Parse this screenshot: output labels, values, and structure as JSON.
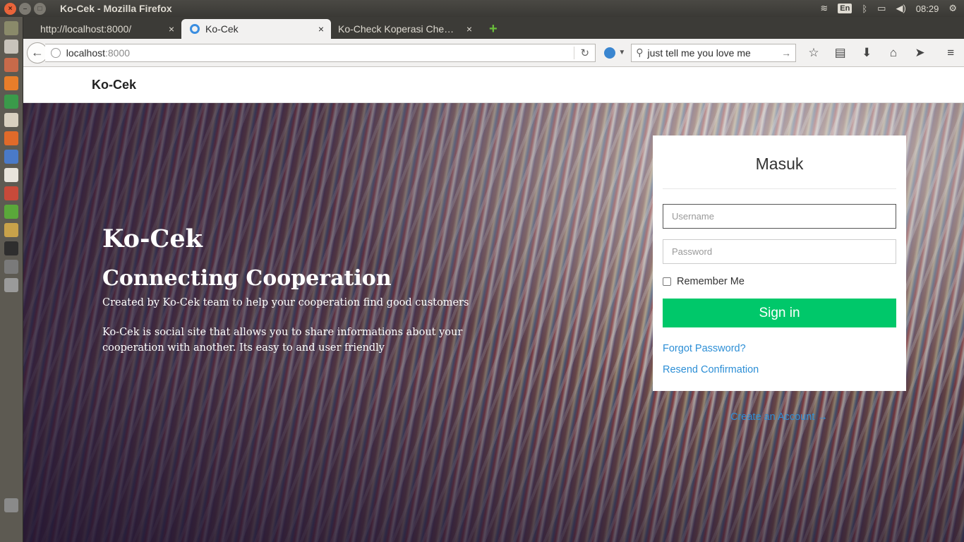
{
  "os": {
    "window_title": "Ko-Cek - Mozilla Firefox",
    "lang": "En",
    "time": "08:29"
  },
  "browser": {
    "tabs": [
      {
        "label": "http://localhost:8000/"
      },
      {
        "label": "Ko-Cek"
      },
      {
        "label": "Ko-Check Koperasi Che…"
      }
    ],
    "url_host": "localhost",
    "url_port": ":8000",
    "search_value": "just tell me you love me"
  },
  "site": {
    "brand": "Ko-Cek",
    "hero": {
      "title": "Ko-Cek",
      "subtitle": "Connecting Cooperation",
      "p1": "Created by Ko-Cek team to help your cooperation find good customers",
      "p2": "Ko-Cek is social site that allows you to share informations about your cooperation with another. Its easy to and user friendly"
    },
    "login": {
      "title": "Masuk",
      "username_placeholder": "Username",
      "password_placeholder": "Password",
      "remember": "Remember Me",
      "signin": "Sign in",
      "forgot": "Forgot Password?",
      "resend": "Resend Confirmation",
      "create": "Create an Account →"
    }
  }
}
